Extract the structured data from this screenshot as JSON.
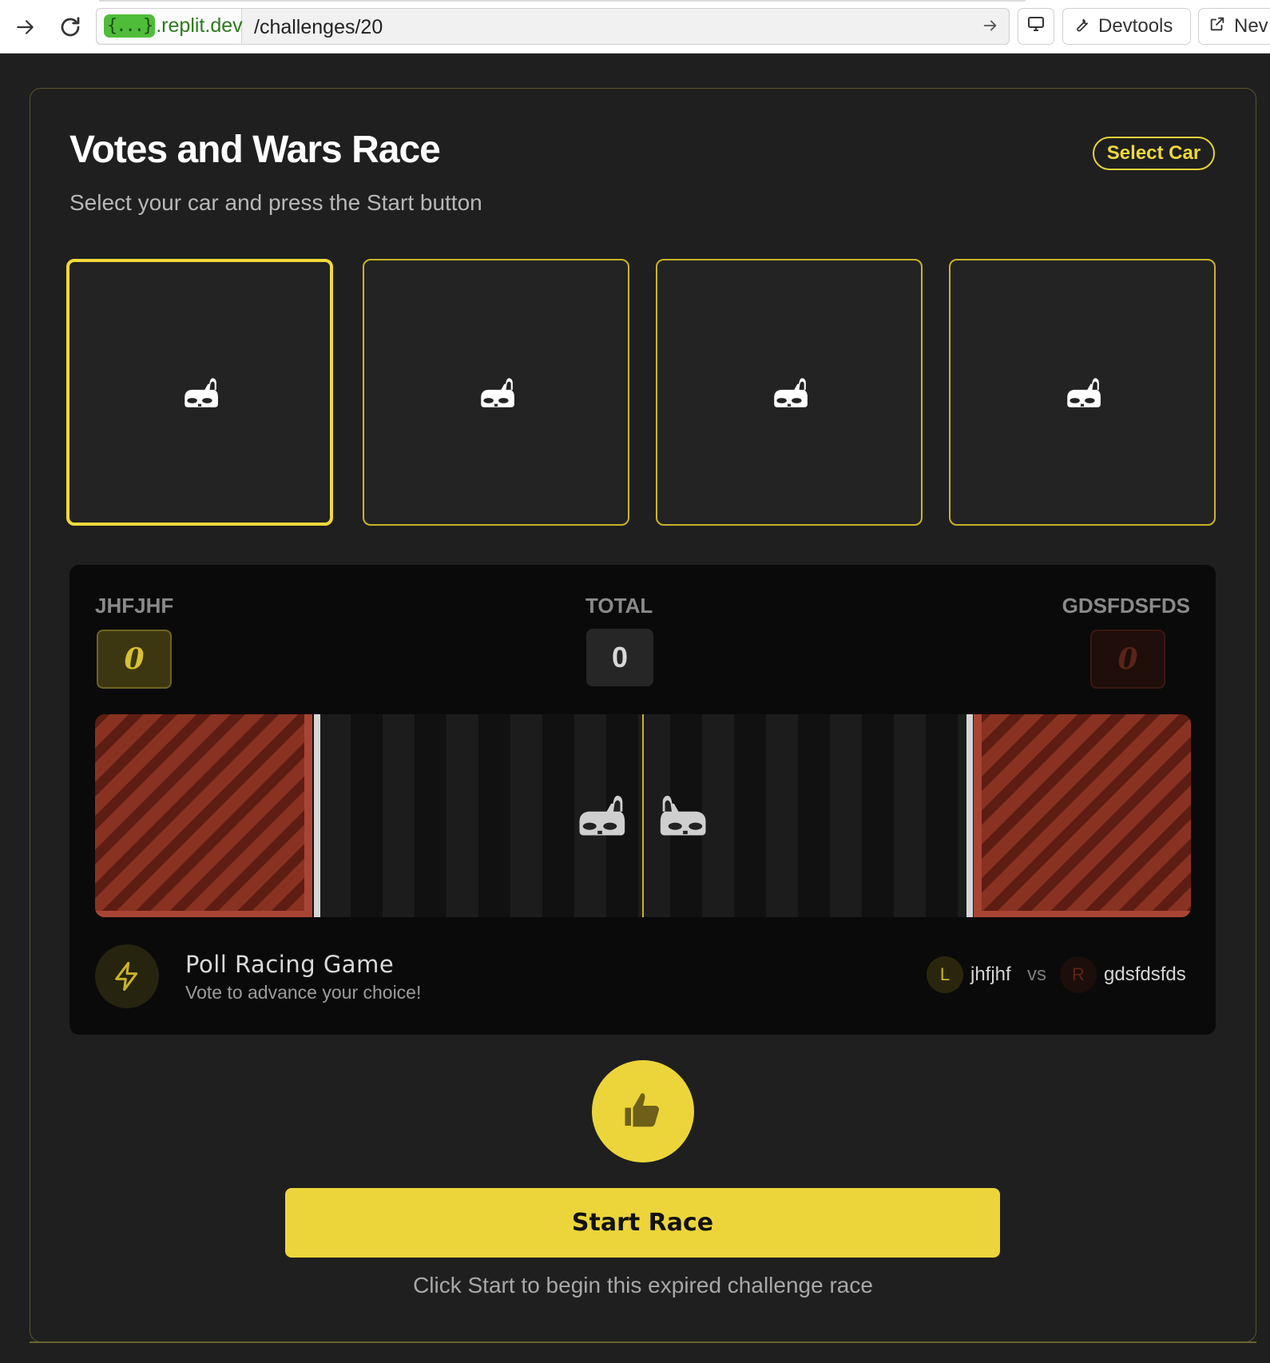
{
  "browser": {
    "domain_badge": "{...}",
    "domain": ".replit.dev",
    "path": "/challenges/20",
    "devtools_label": "Devtools",
    "new_tab_label": "Nev"
  },
  "page": {
    "title": "Votes and Wars Race",
    "subtitle": "Select your car and press the Start button",
    "select_car_label": "Select Car"
  },
  "cars": [
    {
      "icon": "car-icon",
      "selected": true
    },
    {
      "icon": "car-icon",
      "selected": false
    },
    {
      "icon": "car-icon",
      "selected": false
    },
    {
      "icon": "car-icon",
      "selected": false
    }
  ],
  "race": {
    "left_name": "JHFJHF",
    "left_score": "0",
    "total_label": "TOTAL",
    "total_value": "0",
    "right_name": "GDSFDSFDS",
    "right_score": "0",
    "game_title": "Poll Racing Game",
    "game_subtitle": "Vote to advance your choice!",
    "left_avatar": "L",
    "left_player": "jhfjhf",
    "vs": "vs",
    "right_avatar": "R",
    "right_player": "gdsfdsfds"
  },
  "controls": {
    "vote_icon": "thumbs-up-icon",
    "start_label": "Start Race",
    "hint": "Click Start to begin this expired challenge race"
  },
  "colors": {
    "accent": "#ecd53a",
    "background": "#1f1f1f",
    "panel": "#0a0a0a",
    "finish_zone": "#7a2a1c"
  }
}
